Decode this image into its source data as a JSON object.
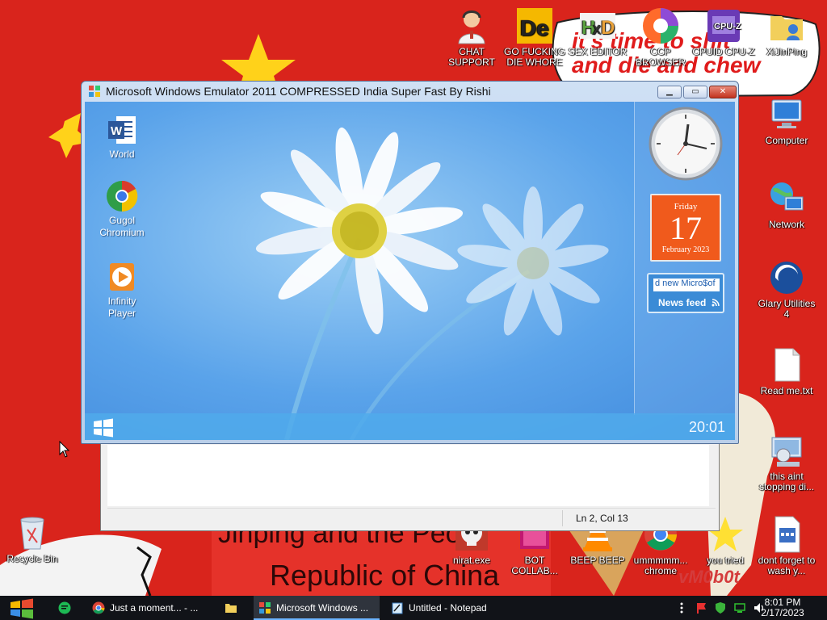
{
  "wallpaper": {
    "meme_top": "it's time to shit\nand die and chew",
    "meme_bottom_1": "Jinping and the Peo",
    "meme_bottom_2": "Republic of China",
    "watermark": "vM0b0t"
  },
  "desktop_icons": [
    {
      "label": "CHAT SUPPORT",
      "icon": "support-agent-icon"
    },
    {
      "label": "GO FUCKING DIE WHORE",
      "icon": "de-app-icon"
    },
    {
      "label": "SEX EDITOR",
      "icon": "hxd-editor-icon"
    },
    {
      "label": "CCP BROWSER",
      "icon": "browser-icon"
    },
    {
      "label": "CPUID CPU-Z",
      "icon": "cpu-z-icon"
    },
    {
      "label": "XiJinPing",
      "icon": "folder-user-icon"
    },
    {
      "label": "Computer",
      "icon": "computer-icon"
    },
    {
      "label": "Network",
      "icon": "network-icon"
    },
    {
      "label": "Glary Utilities 4",
      "icon": "glary-icon"
    },
    {
      "label": "Read me.txt",
      "icon": "text-file-icon"
    },
    {
      "label": "this aint stopping di...",
      "icon": "installer-icon"
    },
    {
      "label": "dont forget to wash y...",
      "icon": "calendar-file-icon"
    },
    {
      "label": "you tried",
      "icon": "star-icon"
    },
    {
      "label": "ummmmm... chrome",
      "icon": "chrome-icon"
    },
    {
      "label": "BEEP BEEP",
      "icon": "vlc-icon"
    },
    {
      "label": "BOT COLLAB...",
      "icon": "bot-collab-icon"
    },
    {
      "label": "nirat.exe",
      "icon": "skull-icon"
    },
    {
      "label": "Recycle Bin",
      "icon": "recycle-bin-icon"
    }
  ],
  "notepad": {
    "status_position": "Ln 2, Col 13"
  },
  "emulator": {
    "title": "Microsoft Windows Emulator 2011 COMPRESSED India Super Fast By Rishi",
    "min_label": "▁",
    "max_label": "▭",
    "close_label": "✕",
    "icons": [
      {
        "label": "World",
        "icon": "word-icon"
      },
      {
        "label": "Gugol Chromium",
        "icon": "chromium-icon"
      },
      {
        "label": "Infinity Player",
        "icon": "media-player-icon"
      }
    ],
    "calendar": {
      "day": "Friday",
      "date": "17",
      "month": "February 2023"
    },
    "feed": {
      "ticker": "d new Micro$of",
      "title": "News feed"
    },
    "clock": "20:01"
  },
  "taskbar": {
    "items": [
      {
        "label": "Just a moment... - ...",
        "icon": "chrome-icon"
      },
      {
        "label": "",
        "icon": "file-explorer-icon"
      },
      {
        "label": "Microsoft Windows ...",
        "icon": "windows-app-icon"
      },
      {
        "label": "Untitled - Notepad",
        "icon": "notepad-icon"
      }
    ],
    "time": "8:01 PM",
    "date": "2/17/2023"
  },
  "colors": {
    "wallpaper_red": "#d9241c",
    "star_yellow": "#ffd21a",
    "emu_sky": "#5aa3ea",
    "taskbar": "#111318"
  }
}
